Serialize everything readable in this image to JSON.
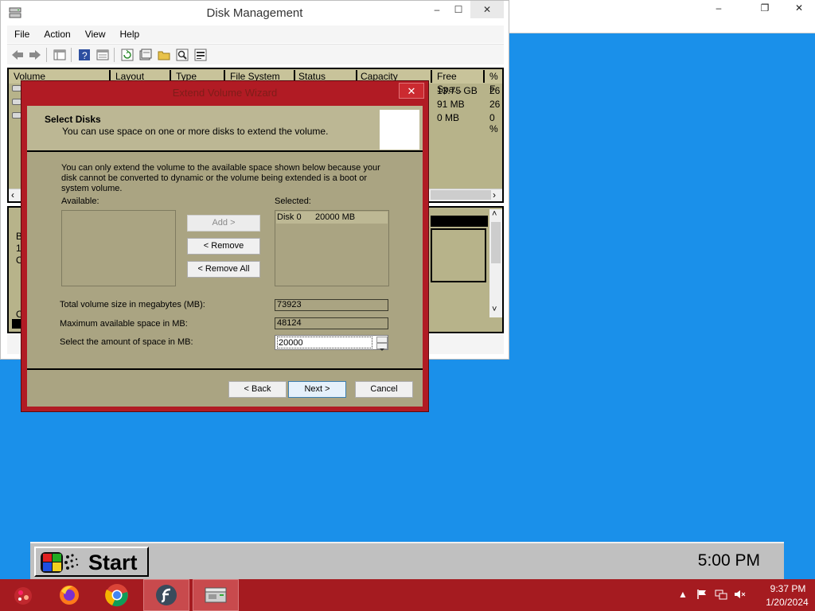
{
  "bg_window": {
    "minimize": "–",
    "restore": "❐",
    "close": "✕"
  },
  "disk_mgmt": {
    "title": "Disk Management",
    "menu": [
      "File",
      "Action",
      "View",
      "Help"
    ],
    "columns": [
      "Volume",
      "Layout",
      "Type",
      "File System",
      "Status",
      "Capacity",
      "Free Spa...",
      "% F"
    ],
    "rows": [
      {
        "free": "13.75 GB",
        "pct": "26"
      },
      {
        "free": "91 MB",
        "pct": "26"
      },
      {
        "free": "0 MB",
        "pct": "0 %"
      }
    ],
    "lower_fragments": [
      "B",
      "1",
      "O",
      "O"
    ]
  },
  "wizard": {
    "title": "Extend Volume Wizard",
    "close": "✕",
    "header_title": "Select Disks",
    "header_subtitle": "You can use space on one or more disks to extend the volume.",
    "info_text": "You can only extend the volume to the available space shown below because your disk cannot be converted to dynamic or the volume being extended is a boot or system volume.",
    "available_label": "Available:",
    "selected_label": "Selected:",
    "selected_items": [
      {
        "disk": "Disk 0",
        "size": "20000 MB"
      }
    ],
    "add_button": "Add >",
    "remove_button": "< Remove",
    "remove_all_button": "< Remove All",
    "total_label": "Total volume size in megabytes (MB):",
    "total_value": "73923",
    "max_label": "Maximum available space in MB:",
    "max_value": "48124",
    "amount_label": "Select the amount of space in MB:",
    "amount_value": "20000",
    "back_button": "< Back",
    "next_button": "Next >",
    "cancel_button": "Cancel"
  },
  "startbar": {
    "label": "Start",
    "clock": "5:00 PM"
  },
  "taskbar": {
    "items": [
      "start-orb",
      "firefox",
      "chrome",
      "flash",
      "disk-management"
    ],
    "time": "9:37 PM",
    "date": "1/20/2024"
  },
  "colors": {
    "desktop": "#1a90ea",
    "taskbar": "#a51b20",
    "wizard_frame": "#b11b24",
    "wizard_body": "#aaa482"
  }
}
